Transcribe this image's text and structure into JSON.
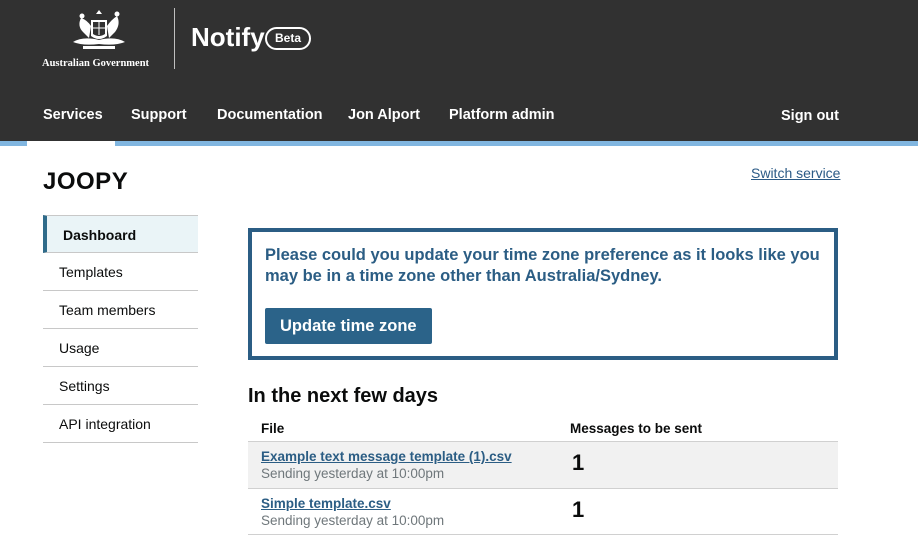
{
  "header": {
    "government_text": "Australian Government",
    "product_name": "Notify",
    "badge": "Beta",
    "nav": [
      "Services",
      "Support",
      "Documentation",
      "Jon Alport",
      "Platform admin"
    ],
    "sign_out": "Sign out"
  },
  "service": {
    "name": "JOOPY",
    "switch_link": "Switch service"
  },
  "sidebar": {
    "items": [
      {
        "label": "Dashboard",
        "active": true
      },
      {
        "label": "Templates"
      },
      {
        "label": "Team members"
      },
      {
        "label": "Usage"
      },
      {
        "label": "Settings"
      },
      {
        "label": "API integration"
      }
    ]
  },
  "banner": {
    "message": "Please could you update your time zone preference as it looks like you may be in a time zone other than Australia/Sydney.",
    "button": "Update time zone"
  },
  "upcoming": {
    "title": "In the next few days",
    "columns": [
      "File",
      "Messages to be sent"
    ],
    "rows": [
      {
        "file": "Example text message template (1).csv",
        "hint": "Sending yesterday at 10:00pm",
        "count": "1"
      },
      {
        "file": "Simple template.csv",
        "hint": "Sending yesterday at 10:00pm",
        "count": "1"
      }
    ]
  },
  "colors": {
    "header_bg": "#313131",
    "stripe": "#81b6e0",
    "accent": "#2b5d84"
  }
}
